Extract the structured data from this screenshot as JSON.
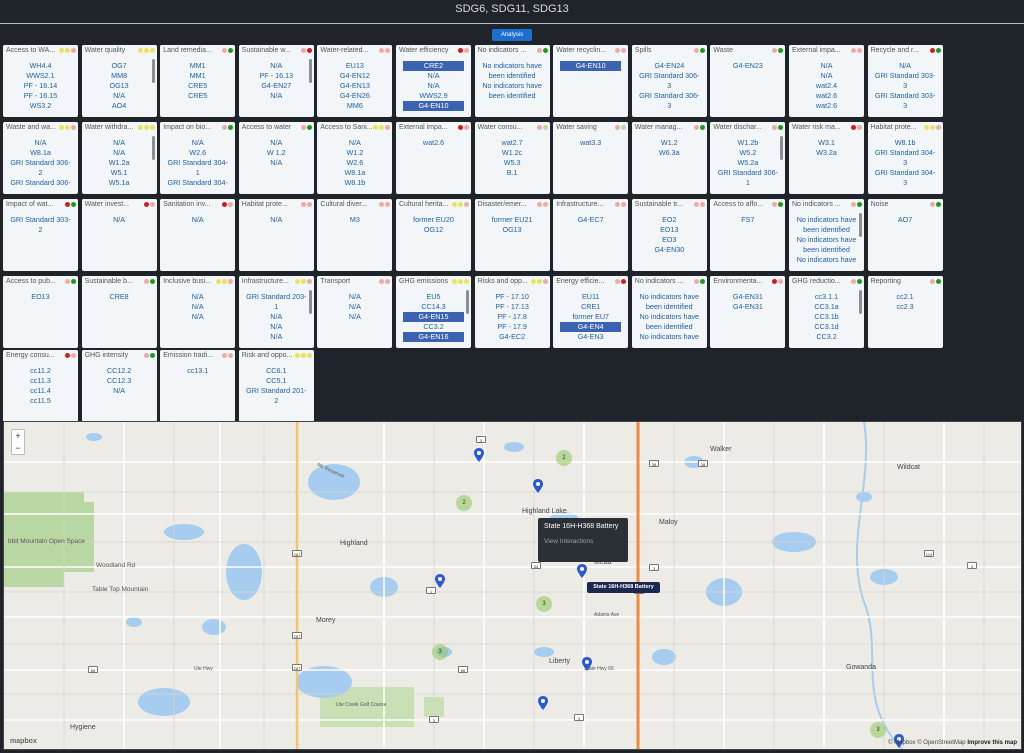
{
  "header": {
    "title": "SDG6, SDG11, SDG13"
  },
  "toolbar": {
    "analysis_label": "Analysis"
  },
  "colors": {
    "red": "#d11c1c",
    "green": "#1a9a1a",
    "yellow": "#e9e35b",
    "pink": "#f0a8a8",
    "lightgreen": "#b6dd9e",
    "highlight": "#3b63b2"
  },
  "cards": [
    {
      "title": "Access to WA...",
      "dots": [
        "yellow",
        "yellow",
        "pink"
      ],
      "items": [
        "WH4.4",
        "WWS2.1",
        "PF - 16.14",
        "PF - 16.15",
        "WS3.2"
      ],
      "hl": []
    },
    {
      "title": "Water quality",
      "dots": [
        "yellow",
        "yellow",
        "yellow"
      ],
      "items": [
        "OG7",
        "MM8",
        "OG13",
        "N/A",
        "AO4"
      ],
      "hl": [],
      "scroll": true
    },
    {
      "title": "Land remedia...",
      "dots": [
        "pink",
        "green"
      ],
      "items": [
        "MM1",
        "MM1",
        "CRE5",
        "CRE5"
      ],
      "hl": []
    },
    {
      "title": "Sustainable w...",
      "dots": [
        "pink",
        "red"
      ],
      "items": [
        "N/A",
        "PF - 16.13",
        "G4-EN27",
        "N/A"
      ],
      "hl": [],
      "scroll": true
    },
    {
      "title": "Water-related...",
      "dots": [
        "pink",
        "pink"
      ],
      "items": [
        "EU13",
        "G4-EN12",
        "G4-EN13",
        "G4-EN26",
        "MM6"
      ],
      "hl": []
    },
    {
      "title": "Water efficiency",
      "dots": [
        "red",
        "pink"
      ],
      "items": [
        "CRE2",
        "N/A",
        "N/A",
        "WWS2.9",
        "G4-EN10"
      ],
      "hl": [
        0,
        4
      ]
    },
    {
      "title": "No indicators ...",
      "dots": [
        "pink",
        "green"
      ],
      "items": [
        "No indicators have",
        "been identified",
        "No indicators have",
        "been identified"
      ],
      "hl": []
    },
    {
      "title": "Water recyclin...",
      "dots": [
        "pink",
        "pink"
      ],
      "items": [
        "G4-EN10"
      ],
      "hl": [
        0
      ]
    },
    {
      "title": "Spills",
      "dots": [
        "pink",
        "green"
      ],
      "items": [
        "G4-EN24",
        "GRI Standard 306-",
        "3",
        "GRI Standard 306-",
        "3"
      ],
      "hl": []
    },
    {
      "title": "Waste",
      "dots": [
        "pink",
        "green"
      ],
      "items": [
        "G4-EN23"
      ],
      "hl": []
    },
    {
      "title": "External impa...",
      "dots": [
        "pink",
        "pink"
      ],
      "items": [
        "N/A",
        "N/A",
        "wat2.4",
        "wat2.6",
        "wat2.6"
      ],
      "hl": []
    },
    {
      "title": "Recycle and r...",
      "dots": [
        "red",
        "green"
      ],
      "items": [
        "N/A",
        "GRI Standard 303-",
        "3",
        "GRI Standard 303-",
        "3"
      ],
      "hl": []
    },
    {
      "title": "Waste and wa...",
      "dots": [
        "yellow",
        "yellow",
        "pink"
      ],
      "items": [
        "N/A",
        "W8.1a",
        "GRI Standard 306-",
        "2",
        "GRI Standard 306-"
      ],
      "hl": []
    },
    {
      "title": "Water withdra...",
      "dots": [
        "yellow",
        "yellow",
        "yellow"
      ],
      "items": [
        "N/A",
        "N/A",
        "W1.2a",
        "W5.1",
        "W5.1a"
      ],
      "hl": [],
      "scroll": true
    },
    {
      "title": "Impact on bio...",
      "dots": [
        "pink",
        "green"
      ],
      "items": [
        "N/A",
        "W2.6",
        "GRI Standard 304-",
        "1",
        "GRI Standard 304-"
      ],
      "hl": []
    },
    {
      "title": "Access to water",
      "dots": [
        "pink",
        "green"
      ],
      "items": [
        "N/A",
        "W 1.2",
        "N/A"
      ],
      "hl": []
    },
    {
      "title": "Access to Sani...",
      "dots": [
        "yellow",
        "yellow",
        "pink"
      ],
      "items": [
        "N/A",
        "W1.2",
        "W2.6",
        "W8.1a",
        "W8.1b"
      ],
      "hl": []
    },
    {
      "title": "External impa...",
      "dots": [
        "red",
        "pink"
      ],
      "items": [
        "wat2.6"
      ],
      "hl": []
    },
    {
      "title": "Water consu...",
      "dots": [
        "pink",
        "lightgreen"
      ],
      "items": [
        "wat2.7",
        "W1.2c",
        "W5.3",
        "B.1"
      ],
      "hl": []
    },
    {
      "title": "Water saving",
      "dots": [
        "pink",
        "lightgreen"
      ],
      "items": [
        "wat3.3"
      ],
      "hl": []
    },
    {
      "title": "Water manag...",
      "dots": [
        "pink",
        "green"
      ],
      "items": [
        "W1.2",
        "W6.3a"
      ],
      "hl": []
    },
    {
      "title": "Water dischar...",
      "dots": [
        "pink",
        "green"
      ],
      "items": [
        "W1.2b",
        "W5.2",
        "W5.2a",
        "GRI Standard 306-",
        "1"
      ],
      "hl": [],
      "scroll": true
    },
    {
      "title": "Water risk ma...",
      "dots": [
        "red",
        "pink"
      ],
      "items": [
        "W3.1",
        "W3.2a"
      ],
      "hl": []
    },
    {
      "title": "Habitat prote...",
      "dots": [
        "yellow",
        "yellow",
        "pink"
      ],
      "items": [
        "W8.1b",
        "GRI Standard 304-",
        "3",
        "GRI Standard 304-",
        "3"
      ],
      "hl": []
    },
    {
      "title": "Impact of wat...",
      "dots": [
        "red",
        "green"
      ],
      "items": [
        "GRI Standard 303-",
        "2"
      ],
      "hl": []
    },
    {
      "title": "Water invest...",
      "dots": [
        "red",
        "pink"
      ],
      "items": [
        "N/A"
      ],
      "hl": []
    },
    {
      "title": "Sanitation inv...",
      "dots": [
        "red",
        "pink"
      ],
      "items": [
        "N/A"
      ],
      "hl": []
    },
    {
      "title": "Habitat prote...",
      "dots": [
        "pink",
        "pink"
      ],
      "items": [
        "N/A"
      ],
      "hl": []
    },
    {
      "title": "Cultural diver...",
      "dots": [
        "pink",
        "pink"
      ],
      "items": [
        "M3"
      ],
      "hl": []
    },
    {
      "title": "Cultural herita...",
      "dots": [
        "yellow",
        "yellow",
        "pink"
      ],
      "items": [
        "former EU20",
        "OG12"
      ],
      "hl": []
    },
    {
      "title": "Disaster/emer...",
      "dots": [
        "pink",
        "pink"
      ],
      "items": [
        "former EU21",
        "OG13"
      ],
      "hl": []
    },
    {
      "title": "Infrastructure...",
      "dots": [
        "pink",
        "pink"
      ],
      "items": [
        "G4-EC7"
      ],
      "hl": []
    },
    {
      "title": "Sustainable tr...",
      "dots": [
        "pink",
        "pink"
      ],
      "items": [
        "EO2",
        "EO13",
        "EO3",
        "G4-EN30"
      ],
      "hl": []
    },
    {
      "title": "Access to affo...",
      "dots": [
        "pink",
        "green"
      ],
      "items": [
        "FS7"
      ],
      "hl": []
    },
    {
      "title": "No indicators ...",
      "dots": [
        "pink",
        "green"
      ],
      "items": [
        "No indicators have",
        "been identified",
        "No indicators have",
        "been identified",
        "No indicators have"
      ],
      "hl": [],
      "scroll": true
    },
    {
      "title": "Noise",
      "dots": [
        "pink",
        "green"
      ],
      "items": [
        "AO7"
      ],
      "hl": []
    },
    {
      "title": "Access to pub...",
      "dots": [
        "pink",
        "green"
      ],
      "items": [
        "EO13"
      ],
      "hl": []
    },
    {
      "title": "Sustainable b...",
      "dots": [
        "pink",
        "green"
      ],
      "items": [
        "CRE8"
      ],
      "hl": []
    },
    {
      "title": "Inclusive busi...",
      "dots": [
        "yellow",
        "yellow",
        "pink"
      ],
      "items": [
        "N/A",
        "N/A",
        "N/A"
      ],
      "hl": []
    },
    {
      "title": "Infrastructure...",
      "dots": [
        "yellow",
        "yellow",
        "pink"
      ],
      "items": [
        "GRI Standard 203-",
        "1",
        "N/A",
        "N/A",
        "N/A"
      ],
      "hl": [],
      "scroll": true
    },
    {
      "title": "Transport",
      "dots": [
        "pink",
        "pink"
      ],
      "items": [
        "N/A",
        "N/A",
        "N/A"
      ],
      "hl": []
    },
    {
      "title": "GHG emissions",
      "dots": [
        "yellow",
        "yellow",
        "yellow"
      ],
      "items": [
        "EU5",
        "CC14.3",
        "G4-EN15",
        "CC3.2",
        "G4-EN16"
      ],
      "hl": [
        2,
        4
      ],
      "scroll": true
    },
    {
      "title": "Risks and opp...",
      "dots": [
        "yellow",
        "yellow",
        "pink"
      ],
      "items": [
        "PF - 17.10",
        "PF - 17.13",
        "PF - 17.8",
        "PF - 17.9",
        "G4-EC2"
      ],
      "hl": []
    },
    {
      "title": "Energy efficie...",
      "dots": [
        "pink",
        "red"
      ],
      "items": [
        "EU11",
        "CRE1",
        "former EU7",
        "G4-EN4",
        "G4-EN3"
      ],
      "hl": [
        3
      ]
    },
    {
      "title": "No indicators ...",
      "dots": [
        "pink",
        "green"
      ],
      "items": [
        "No indicators have",
        "been identified",
        "No indicators have",
        "been identified",
        "No indicators have"
      ],
      "hl": []
    },
    {
      "title": "Environmenta...",
      "dots": [
        "red",
        "pink"
      ],
      "items": [
        "G4-EN31",
        "G4-EN31"
      ],
      "hl": []
    },
    {
      "title": "GHG reductio...",
      "dots": [
        "pink",
        "green"
      ],
      "items": [
        "cc3.1.1",
        "CC3.1a",
        "CC3.1b",
        "CC3.1d",
        "CC3.2"
      ],
      "hl": [],
      "scroll": true
    },
    {
      "title": "Reporting",
      "dots": [
        "pink",
        "green"
      ],
      "items": [
        "cc2.1",
        "cc2.3"
      ],
      "hl": []
    },
    {
      "title": "Energy consu...",
      "dots": [
        "red",
        "pink"
      ],
      "items": [
        "cc11.2",
        "cc11.3",
        "cc11.4",
        "cc11.5"
      ],
      "hl": []
    },
    {
      "title": "GHG intensity",
      "dots": [
        "pink",
        "green"
      ],
      "items": [
        "CC12.2",
        "CC12.3",
        "N/A"
      ],
      "hl": []
    },
    {
      "title": "Emission tradi...",
      "dots": [
        "pink",
        "pink"
      ],
      "items": [
        "cc13.1"
      ],
      "hl": []
    },
    {
      "title": "Risk and oppo...",
      "dots": [
        "yellow",
        "yellow",
        "yellow"
      ],
      "items": [
        "CC6.1",
        "CC5.1",
        "GRI Standard 201-",
        "2"
      ],
      "hl": []
    }
  ],
  "map": {
    "zoom_in": "+",
    "zoom_out": "−",
    "popup_title": "State 16H-H368 Battery",
    "popup_link": "View Interactions",
    "tooltip": "State 16H-H368 Battery",
    "logo": "mapbox",
    "attribution_a": "© Mapbox © OpenStreetMap ",
    "attribution_b": "Improve this map",
    "places": {
      "walker": "Walker",
      "wildcat": "Wildcat",
      "highland_lake": "Highland Lake",
      "maloy": "Maloy",
      "highland": "Highland",
      "woodland": "Woodland Rd",
      "table_top": "Table Top Mountain",
      "morey": "Morey",
      "liberty": "Liberty",
      "gowanda": "Gowanda",
      "hygiene": "Hygiene",
      "mead": "Mead",
      "open_space": "bbit Mountain\nOpen Space",
      "golf": "Ute Creek Golf Course",
      "adams": "Adams Ave",
      "state_hwy": "State Hwy 66",
      "ute_hwy": "Ute Hwy",
      "reservoir": "Mc Reservoir"
    },
    "clusters": [
      "2",
      "2",
      "3",
      "3",
      "3"
    ],
    "shields": [
      "3",
      "3",
      "38",
      "34",
      "287",
      "1",
      "287",
      "287",
      "66",
      "66",
      "119",
      "3",
      "3",
      "3",
      "3",
      "25"
    ]
  }
}
